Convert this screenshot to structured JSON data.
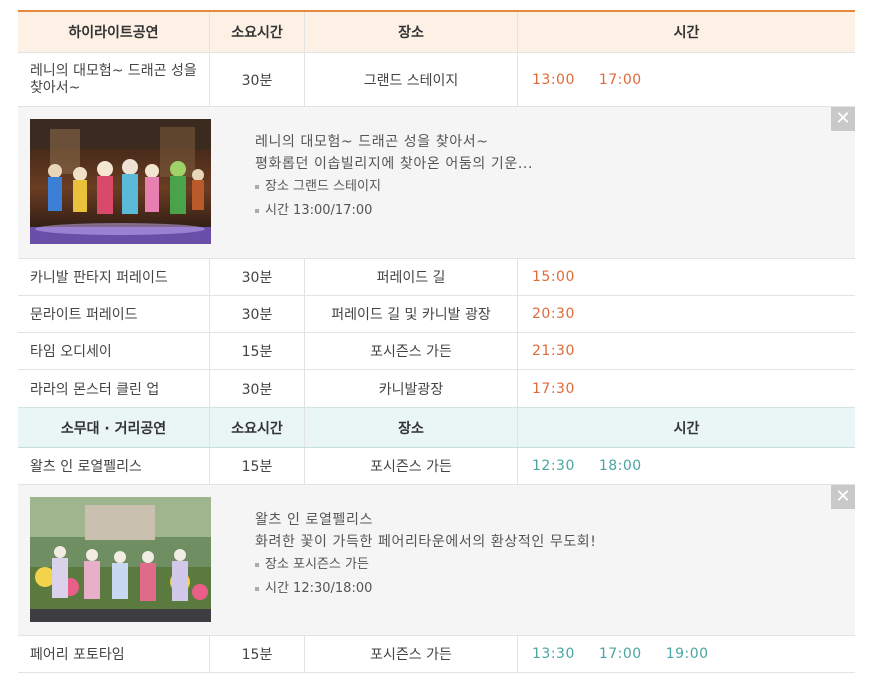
{
  "section1": {
    "headers": {
      "name": "하이라이트공연",
      "duration": "소요시간",
      "place": "장소",
      "time": "시간"
    },
    "rows": [
      {
        "name": "레니의 대모험~ 드래곤 성을 찾아서~",
        "duration": "30분",
        "place": "그랜드 스테이지",
        "times": [
          "13:00",
          "17:00"
        ]
      },
      {
        "name": "카니발 판타지 퍼레이드",
        "duration": "30분",
        "place": "퍼레이드 길",
        "times": [
          "15:00"
        ]
      },
      {
        "name": "문라이트 퍼레이드",
        "duration": "30분",
        "place": "퍼레이드 길 및 카니발 광장",
        "times": [
          "20:30"
        ]
      },
      {
        "name": "타임 오디세이",
        "duration": "15분",
        "place": "포시즌스 가든",
        "times": [
          "21:30"
        ]
      },
      {
        "name": "라라의 몬스터 클린 업",
        "duration": "30분",
        "place": "카니발광장",
        "times": [
          "17:30"
        ]
      }
    ],
    "detail": {
      "line1": "레니의 대모험~ 드래곤 성을 찾아서~",
      "line2": "평화롭던 이솝빌리지에 찾아온 어둠의 기운...",
      "place": "장소 그랜드 스테이지",
      "time": "시간 13:00/17:00",
      "close": "✕"
    }
  },
  "section2": {
    "headers": {
      "name": "소무대 · 거리공연",
      "duration": "소요시간",
      "place": "장소",
      "time": "시간"
    },
    "rows": [
      {
        "name": "왈츠 인 로열펠리스",
        "duration": "15분",
        "place": "포시즌스 가든",
        "times": [
          "12:30",
          "18:00"
        ]
      },
      {
        "name": "페어리 포토타임",
        "duration": "15분",
        "place": "포시즌스 가든",
        "times": [
          "13:30",
          "17:00",
          "19:00"
        ]
      }
    ],
    "detail": {
      "line1": "왈츠 인 로열펠리스",
      "line2": "화려한 꽃이 가득한 페어리타운에서의 환상적인 무도회!",
      "place": "장소 포시즌스 가든",
      "time": "시간 12:30/18:00",
      "close": "✕"
    }
  },
  "colors": {
    "accent": "#e8863a",
    "orange_time": "#e06a3a",
    "teal_time": "#4aa5a2"
  }
}
